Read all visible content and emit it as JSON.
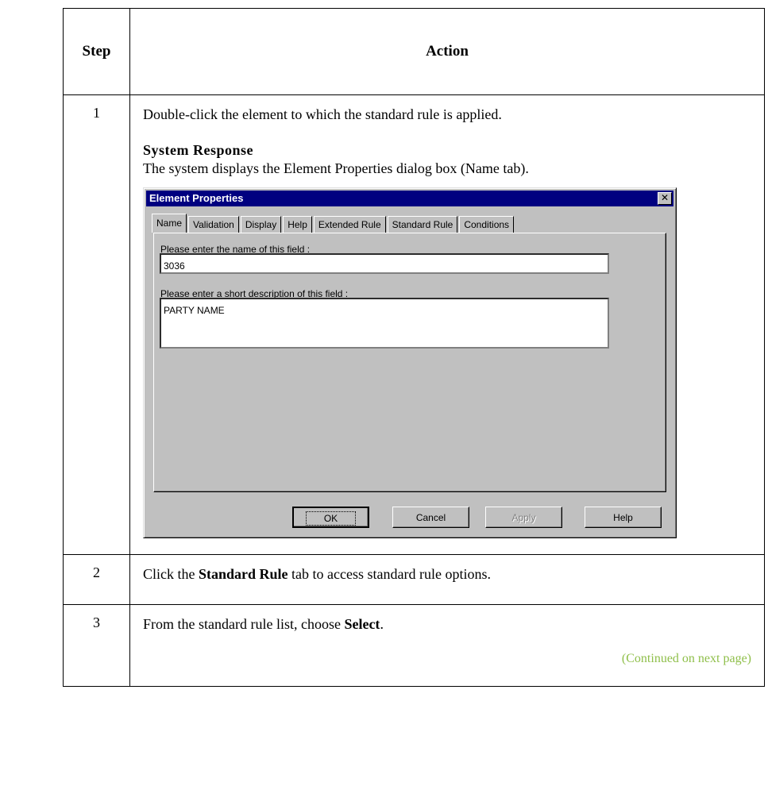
{
  "table": {
    "header": {
      "step": "Step",
      "action": "Action"
    },
    "rows": [
      {
        "step": "1",
        "instruction": "Double-click the element to which the standard rule is applied.",
        "system_response_heading": "System Response",
        "system_response_text": "The system displays the Element Properties dialog box (Name tab)."
      },
      {
        "step": "2",
        "text_before": "Click the ",
        "bold": "Standard Rule",
        "text_after": " tab to access standard rule options."
      },
      {
        "step": "3",
        "text_before": "From the standard rule list, choose ",
        "bold": "Select",
        "text_after": "."
      }
    ],
    "continued_note": "(Continued on next page)"
  },
  "dialog": {
    "title": "Element Properties",
    "close_glyph": "✕",
    "tabs": [
      "Name",
      "Validation",
      "Display",
      "Help",
      "Extended Rule",
      "Standard Rule",
      "Conditions"
    ],
    "active_tab": "Name",
    "name_label": "Please enter the name of this field :",
    "name_value": "3036",
    "desc_label": "Please enter a short description of this field :",
    "desc_value": "PARTY NAME",
    "buttons": {
      "ok": "OK",
      "cancel": "Cancel",
      "apply": "Apply",
      "help": "Help"
    }
  },
  "colors": {
    "titlebar": "#000080",
    "dialog_bg": "#c0c0c0",
    "continued": "#8fbf4a"
  }
}
